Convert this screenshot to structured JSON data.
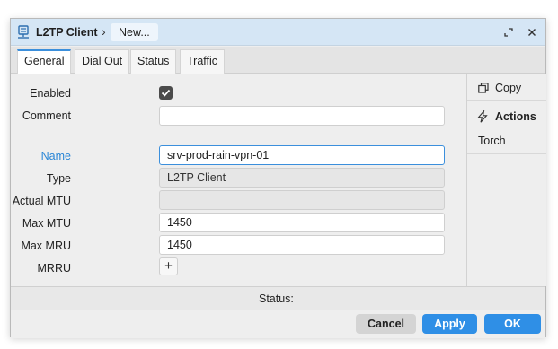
{
  "window": {
    "title": "L2TP Client",
    "breadcrumb": "New...",
    "icons": [
      "network-adapter-icon",
      "restore-icon",
      "close-icon"
    ]
  },
  "tabs": [
    {
      "label": "General",
      "active": true
    },
    {
      "label": "Dial Out",
      "active": false
    },
    {
      "label": "Status",
      "active": false
    },
    {
      "label": "Traffic",
      "active": false
    }
  ],
  "form": {
    "enabled": {
      "label": "Enabled",
      "checked": true
    },
    "comment": {
      "label": "Comment",
      "value": ""
    },
    "name": {
      "label": "Name",
      "value": "srv-prod-rain-vpn-01"
    },
    "type": {
      "label": "Type",
      "value": "L2TP Client"
    },
    "actual_mtu": {
      "label": "Actual MTU",
      "value": ""
    },
    "max_mtu": {
      "label": "Max MTU",
      "value": "1450"
    },
    "max_mru": {
      "label": "Max MRU",
      "value": "1450"
    },
    "mrru": {
      "label": "MRRU",
      "button": "+"
    }
  },
  "sidebar": {
    "copy": "Copy",
    "actions": "Actions",
    "torch": "Torch"
  },
  "status": {
    "label": "Status:"
  },
  "buttons": {
    "cancel": "Cancel",
    "apply": "Apply",
    "ok": "OK"
  },
  "colors": {
    "accent": "#2f8fe6",
    "titlebar": "#d5e6f5",
    "name_label": "#2a86d6"
  }
}
